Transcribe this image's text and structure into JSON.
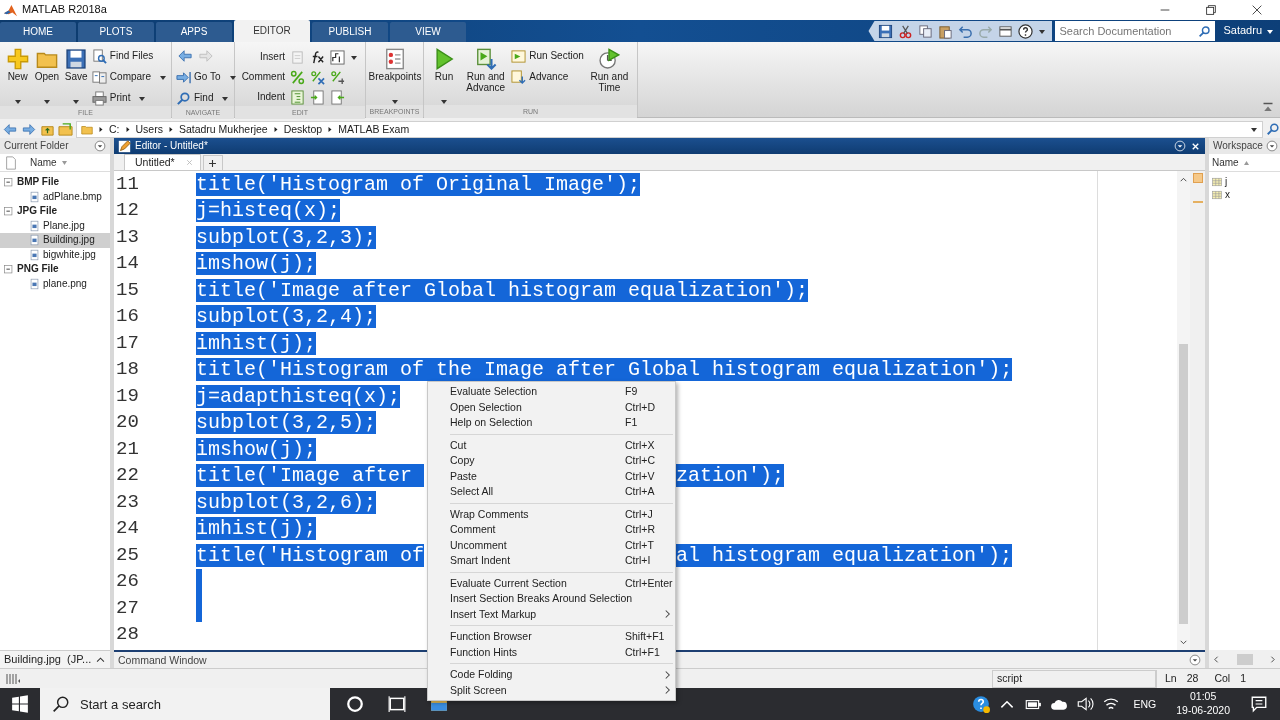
{
  "window": {
    "title": "MATLAB R2018a"
  },
  "tabs": [
    {
      "label": "HOME",
      "selected": false
    },
    {
      "label": "PLOTS",
      "selected": false
    },
    {
      "label": "APPS",
      "selected": false
    },
    {
      "label": "EDITOR",
      "selected": true
    },
    {
      "label": "PUBLISH",
      "selected": false
    },
    {
      "label": "VIEW",
      "selected": false
    }
  ],
  "search": {
    "placeholder": "Search Documentation"
  },
  "user": {
    "label": "Satadru"
  },
  "ribbon": {
    "groups": [
      {
        "label": "FILE",
        "controls": [
          {
            "kind": "large",
            "label": "New",
            "dropdown": true
          },
          {
            "kind": "large",
            "label": "Open",
            "dropdown": true
          },
          {
            "kind": "large",
            "label": "Save",
            "dropdown": true
          },
          {
            "kind": "stack",
            "items": [
              {
                "kind": "item",
                "label": "Find Files",
                "dropdown": false
              },
              {
                "kind": "item",
                "label": "Compare",
                "dropdown": true
              },
              {
                "kind": "item",
                "label": "Print",
                "dropdown": true
              }
            ]
          }
        ]
      },
      {
        "label": "NAVIGATE",
        "controls": [
          {
            "kind": "stack",
            "items": [
              {
                "kind": "history",
                "back_enabled": true,
                "forward_enabled": false
              },
              {
                "kind": "item",
                "label": "Go To",
                "dropdown": true
              },
              {
                "kind": "item",
                "label": "Find",
                "dropdown": true
              }
            ]
          }
        ]
      },
      {
        "label": "EDIT",
        "controls": [
          {
            "kind": "rows",
            "rows": [
              {
                "label": "Insert",
                "dropdown": true
              },
              {
                "label": "Comment",
                "dropdown": false
              },
              {
                "label": "Indent",
                "dropdown": false
              }
            ]
          }
        ]
      },
      {
        "label": "BREAKPOINTS",
        "controls": [
          {
            "kind": "large",
            "label": "Breakpoints",
            "dropdown": true
          }
        ]
      },
      {
        "label": "RUN",
        "controls": [
          {
            "kind": "large",
            "label": "Run",
            "dropdown": true
          },
          {
            "kind": "large",
            "label": "Run and Advance",
            "dropdown": false
          },
          {
            "kind": "stack",
            "items": [
              {
                "kind": "item",
                "label": "Run Section",
                "dropdown": false
              },
              {
                "kind": "item",
                "label": "Advance",
                "dropdown": false
              }
            ]
          },
          {
            "kind": "large",
            "label": "Run and Time",
            "dropdown": false
          }
        ]
      }
    ]
  },
  "address": {
    "path": [
      "C:",
      "Users",
      "Satadru Mukherjee",
      "Desktop",
      "MATLAB Exam"
    ]
  },
  "current_folder": {
    "title": "Current Folder",
    "column": "Name",
    "tree": [
      {
        "label": "BMP File",
        "expanded": true,
        "children": [
          {
            "label": "adPlane.bmp",
            "selected": false
          }
        ]
      },
      {
        "label": "JPG File",
        "expanded": true,
        "children": [
          {
            "label": "Plane.jpg",
            "selected": false
          },
          {
            "label": "Building.jpg",
            "selected": true
          },
          {
            "label": "bigwhite.jpg",
            "selected": false
          }
        ]
      },
      {
        "label": "PNG File",
        "expanded": true,
        "children": [
          {
            "label": "plane.png",
            "selected": false
          }
        ]
      }
    ],
    "details": "Building.jpg  (JP..."
  },
  "editor": {
    "title": "Editor - Untitled*",
    "tabs": [
      {
        "label": "Untitled*",
        "selected": true
      }
    ],
    "lines": [
      {
        "number": "11",
        "selected": true,
        "parts": [
          "title('Histogram of Original Image');"
        ]
      },
      {
        "number": "12",
        "selected": true,
        "parts": [
          "j=histeq(x);"
        ]
      },
      {
        "number": "13",
        "selected": true,
        "parts": [
          "subplot(3,2,3);"
        ]
      },
      {
        "number": "14",
        "selected": true,
        "parts": [
          "imshow(j);"
        ]
      },
      {
        "number": "15",
        "selected": true,
        "parts": [
          "title('Image after Global histogram equalization');"
        ]
      },
      {
        "number": "16",
        "selected": true,
        "parts": [
          "subplot(3,2,4);"
        ]
      },
      {
        "number": "17",
        "selected": true,
        "parts": [
          "imhist(j);"
        ]
      },
      {
        "number": "18",
        "selected": true,
        "parts": [
          "title('Histogram of the Image after Global histogram equalization');"
        ]
      },
      {
        "number": "19",
        "selected": true,
        "parts": [
          "j=adapthisteq(x);"
        ]
      },
      {
        "number": "20",
        "selected": true,
        "parts": [
          "subplot(3,2,5);"
        ]
      },
      {
        "number": "21",
        "selected": true,
        "parts": [
          "imshow(j);"
        ]
      },
      {
        "number": "22",
        "selected": true,
        "parts": [
          "title('Image after ",
          "zation');"
        ]
      },
      {
        "number": "23",
        "selected": true,
        "parts": [
          "subplot(3,2,6);"
        ]
      },
      {
        "number": "24",
        "selected": true,
        "parts": [
          "imhist(j);"
        ]
      },
      {
        "number": "25",
        "selected": true,
        "parts": [
          "title('Histogram of",
          "al histogram equalization');"
        ]
      },
      {
        "number": "26",
        "selected": true
      },
      {
        "number": "27",
        "selected": true
      },
      {
        "number": "28",
        "selected": false
      }
    ]
  },
  "command_window": {
    "title": "Command Window"
  },
  "workspace": {
    "title": "Workspace",
    "column": "Name",
    "variables": [
      {
        "name": "j"
      },
      {
        "name": "x"
      }
    ]
  },
  "context_menu": {
    "groups": [
      [
        {
          "label": "Evaluate Selection",
          "shortcut": "F9",
          "submenu": false
        },
        {
          "label": "Open Selection",
          "shortcut": "Ctrl+D",
          "submenu": false
        },
        {
          "label": "Help on Selection",
          "shortcut": "F1",
          "submenu": false
        }
      ],
      [
        {
          "label": "Cut",
          "shortcut": "Ctrl+X",
          "submenu": false
        },
        {
          "label": "Copy",
          "shortcut": "Ctrl+C",
          "submenu": false
        },
        {
          "label": "Paste",
          "shortcut": "Ctrl+V",
          "submenu": false
        },
        {
          "label": "Select All",
          "shortcut": "Ctrl+A",
          "submenu": false
        }
      ],
      [
        {
          "label": "Wrap Comments",
          "shortcut": "Ctrl+J",
          "submenu": false
        },
        {
          "label": "Comment",
          "shortcut": "Ctrl+R",
          "submenu": false
        },
        {
          "label": "Uncomment",
          "shortcut": "Ctrl+T",
          "submenu": false
        },
        {
          "label": "Smart Indent",
          "shortcut": "Ctrl+I",
          "submenu": false
        }
      ],
      [
        {
          "label": "Evaluate Current Section",
          "shortcut": "Ctrl+Enter",
          "submenu": false
        },
        {
          "label": "Insert Section Breaks Around Selection",
          "submenu": false
        },
        {
          "label": "Insert Text Markup",
          "submenu": true
        }
      ],
      [
        {
          "label": "Function Browser",
          "shortcut": "Shift+F1",
          "submenu": false
        },
        {
          "label": "Function Hints",
          "shortcut": "Ctrl+F1",
          "submenu": false
        }
      ],
      [
        {
          "label": "Code Folding",
          "submenu": true
        },
        {
          "label": "Split Screen",
          "submenu": true
        }
      ]
    ]
  },
  "status_bar": {
    "file_type": "script",
    "line_label": "Ln",
    "line": "28",
    "col_label": "Col",
    "col": "1"
  },
  "taskbar": {
    "search_placeholder": "Start a search",
    "language": "ENG",
    "time": "01:05",
    "date": "19-06-2020"
  }
}
